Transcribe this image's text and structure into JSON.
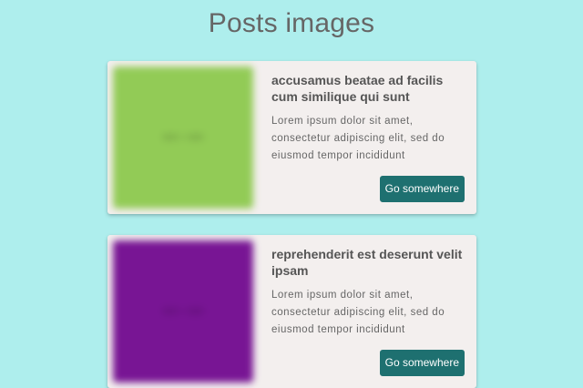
{
  "page": {
    "title": "Posts images"
  },
  "posts": [
    {
      "title": "accusamus beatae ad facilis cum similique qui sunt",
      "text": "Lorem ipsum dolor sit amet, consectetur adipiscing elit, sed do eiusmod tempor incididunt",
      "button_label": "Go somewhere",
      "image_color": "#92cb56",
      "image_label": "600 × 600"
    },
    {
      "title": "reprehenderit est deserunt velit ipsam",
      "text": "Lorem ipsum dolor sit amet, consectetur adipiscing elit, sed do eiusmod tempor incididunt",
      "button_label": "Go somewhere",
      "image_color": "#781594",
      "image_label": "600 × 600"
    }
  ],
  "colors": {
    "background": "#aeeeed",
    "card": "#f3efee",
    "button": "#1e7070"
  }
}
